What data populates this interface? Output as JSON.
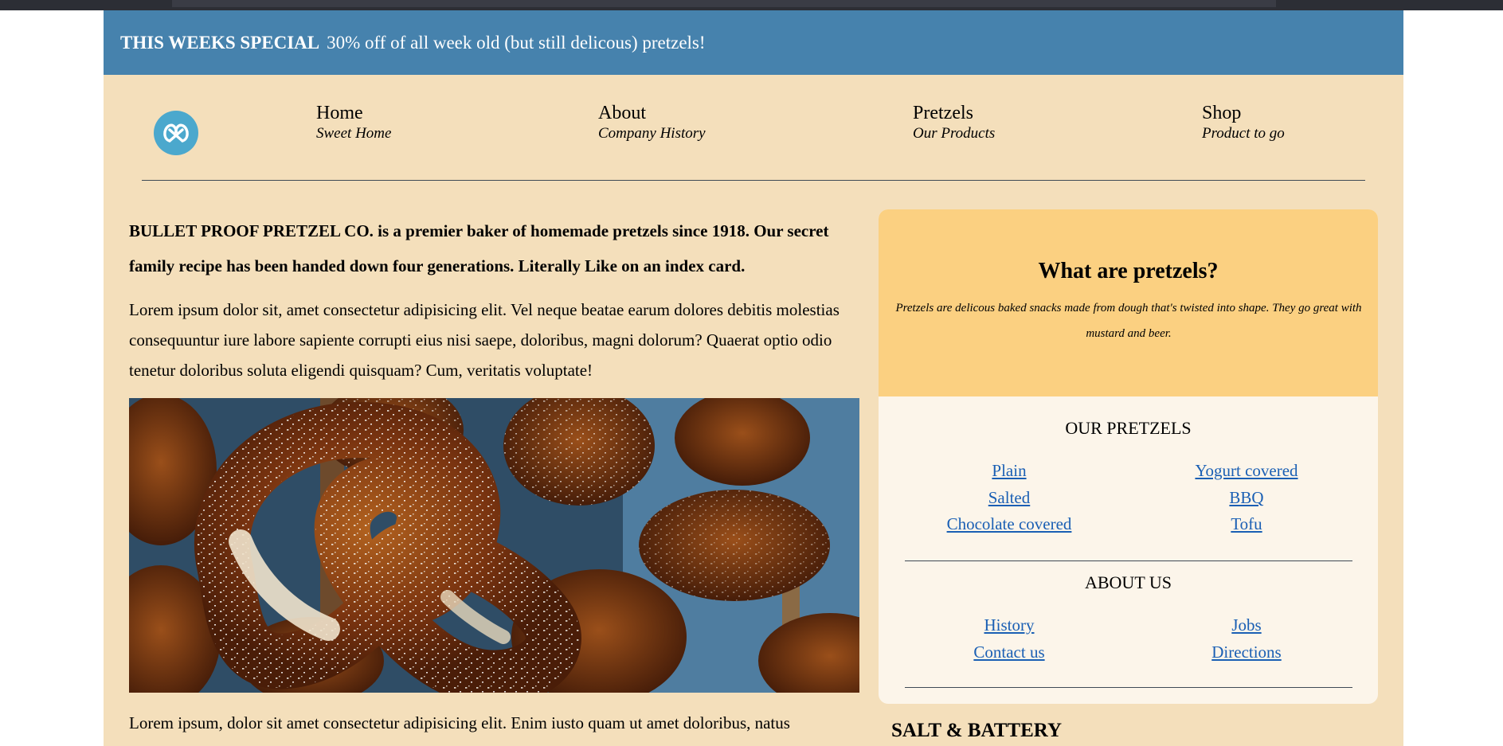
{
  "special": {
    "label": "THIS WEEKS SPECIAL",
    "text": "30% off of all week old (but still delicous) pretzels!"
  },
  "nav": {
    "logo_icon": "pretzel-icon",
    "items": [
      {
        "title": "Home",
        "subtitle": "Sweet Home"
      },
      {
        "title": "About",
        "subtitle": "Company History"
      },
      {
        "title": "Pretzels",
        "subtitle": "Our Products"
      },
      {
        "title": "Shop",
        "subtitle": "Product to go"
      }
    ]
  },
  "main": {
    "intro": "BULLET PROOF PRETZEL CO. is a premier baker of homemade pretzels since 1918. Our secret family recipe has been handed down four generations. Literally Like on an index card.",
    "paragraph1": "Lorem ipsum dolor sit, amet consectetur adipisicing elit. Vel neque beatae earum dolores debitis molestias consequuntur iure labore sapiente corrupti eius nisi saepe, doloribus, magni dolorum? Quaerat optio odio tenetur doloribus soluta eligendi quisquam? Cum, veritatis voluptate!",
    "paragraph2": "Lorem ipsum, dolor sit amet consectetur adipisicing elit. Enim iusto quam ut amet doloribus, natus"
  },
  "sidebar": {
    "title": "What are pretzels?",
    "description": "Pretzels are delicous baked snacks made from dough that's twisted into shape. They go great with mustard and beer.",
    "pretzels_heading": "OUR PRETZELS",
    "pretzel_links": [
      "Plain",
      "Yogurt covered",
      "Salted",
      "BBQ",
      "Chocolate covered",
      "Tofu"
    ],
    "about_heading": "ABOUT US",
    "about_links": [
      "History",
      "Jobs",
      "Contact us",
      "Directions"
    ]
  },
  "next_section": {
    "title": "SALT & BATTERY"
  },
  "colors": {
    "banner": "#4682ad",
    "page_bg": "#f4dfbb",
    "sidebar_top": "#fbd081",
    "sidebar_bg": "#fcf5ea",
    "link": "#1a5fb4",
    "logo": "#4ba8cd"
  }
}
